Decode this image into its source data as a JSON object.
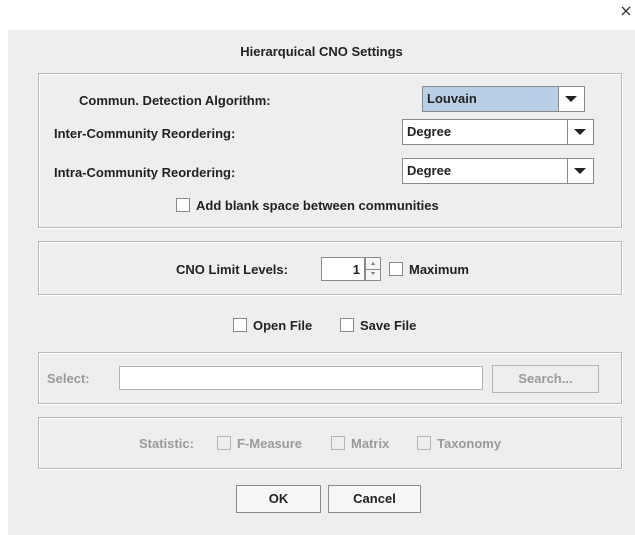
{
  "window": {
    "close_icon": "×",
    "title": "Hierarquical CNO Settings"
  },
  "algorithm_panel": {
    "detection_label": "Commun. Detection Algorithm:",
    "detection_value": "Louvain",
    "inter_label": "Inter-Community Reordering:",
    "inter_value": "Degree",
    "intra_label": "Intra-Community Reordering:",
    "intra_value": "Degree",
    "blank_space_label": "Add blank space between communities"
  },
  "limit_panel": {
    "label": "CNO Limit Levels:",
    "value": "1",
    "maximum_label": "Maximum"
  },
  "file_options": {
    "open_label": "Open File",
    "save_label": "Save File"
  },
  "select_panel": {
    "label": "Select:",
    "value": "",
    "search_button": "Search..."
  },
  "statistic_panel": {
    "label": "Statistic:",
    "fmeasure_label": "F-Measure",
    "matrix_label": "Matrix",
    "taxonomy_label": "Taxonomy"
  },
  "buttons": {
    "ok": "OK",
    "cancel": "Cancel"
  },
  "colors": {
    "dialog_bg": "#eeeeee",
    "selected_combo_bg": "#b8cfe5",
    "disabled_text": "#9a9a9a"
  }
}
